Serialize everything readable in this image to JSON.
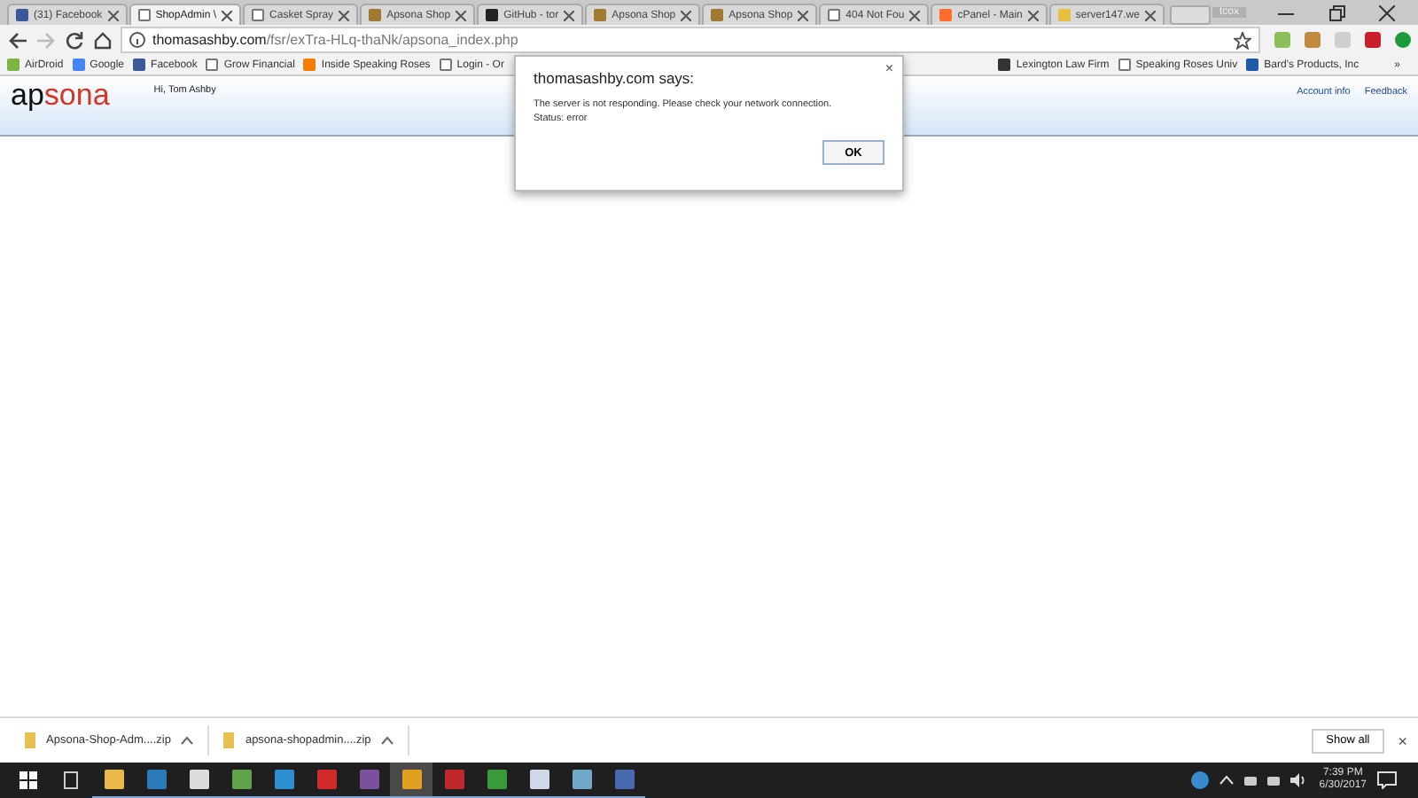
{
  "tabs": [
    {
      "label": "(31) Facebook",
      "kind": "facebook",
      "selected": false
    },
    {
      "label": "ShopAdmin \\",
      "kind": "page",
      "selected": true
    },
    {
      "label": "Casket Spray",
      "kind": "page",
      "selected": false
    },
    {
      "label": "Apsona Shop",
      "kind": "apsona",
      "selected": false
    },
    {
      "label": "GitHub - tor",
      "kind": "github",
      "selected": false
    },
    {
      "label": "Apsona Shop",
      "kind": "apsona",
      "selected": false
    },
    {
      "label": "Apsona Shop",
      "kind": "apsona",
      "selected": false
    },
    {
      "label": "404 Not Fou",
      "kind": "page",
      "selected": false
    },
    {
      "label": "cPanel - Main",
      "kind": "cpanel",
      "selected": false
    },
    {
      "label": "server147.we",
      "kind": "server",
      "selected": false
    }
  ],
  "profile": "tcox",
  "address": {
    "host": "thomasashby.com",
    "path": "/fsr/exTra-HLq-thaNk/apsona_index.php"
  },
  "bookmarks_left": [
    {
      "label": "AirDroid",
      "kind": "airdroid"
    },
    {
      "label": "Google",
      "kind": "google"
    },
    {
      "label": "Facebook",
      "kind": "facebook"
    },
    {
      "label": "Grow Financial",
      "kind": "page"
    },
    {
      "label": "Inside Speaking Roses",
      "kind": "rss"
    },
    {
      "label": "Login - Or",
      "kind": "page"
    }
  ],
  "bookmarks_right": [
    {
      "label": "Lexington Law Firm",
      "kind": "bottle"
    },
    {
      "label": "Speaking Roses Univ",
      "kind": "page"
    },
    {
      "label": "Bard's Products, Inc",
      "kind": "globe"
    }
  ],
  "bookmarks_more": "»",
  "header": {
    "logo": {
      "dark": "ap",
      "accent": "sona"
    },
    "greeting": "Hi, Tom Ashby",
    "links": [
      "Account info",
      "Feedback"
    ]
  },
  "dialog": {
    "title": "thomasashby.com says:",
    "lines": [
      "The server is not responding. Please check your network connection.",
      "Status: error"
    ],
    "button": "OK",
    "close": "×"
  },
  "downloads": {
    "items": [
      {
        "name": "Apsona-Shop-Adm....zip"
      },
      {
        "name": "apsona-shopadmin....zip"
      }
    ],
    "show_all": "Show all",
    "close": "×"
  },
  "taskbar": {
    "apps": [
      {
        "kind": "explorer",
        "selected": false
      },
      {
        "kind": "browser",
        "selected": false
      },
      {
        "kind": "calculator",
        "selected": false
      },
      {
        "kind": "image",
        "selected": false
      },
      {
        "kind": "chat",
        "selected": false
      },
      {
        "kind": "text",
        "selected": false
      },
      {
        "kind": "viber",
        "selected": false
      },
      {
        "kind": "chrome",
        "selected": true
      },
      {
        "kind": "filezilla",
        "selected": false
      },
      {
        "kind": "publisher",
        "selected": false
      },
      {
        "kind": "document",
        "selected": false
      },
      {
        "kind": "notebook",
        "selected": false
      },
      {
        "kind": "viewer",
        "selected": false
      }
    ],
    "time": "7:39 PM",
    "date": "6/30/2017"
  }
}
